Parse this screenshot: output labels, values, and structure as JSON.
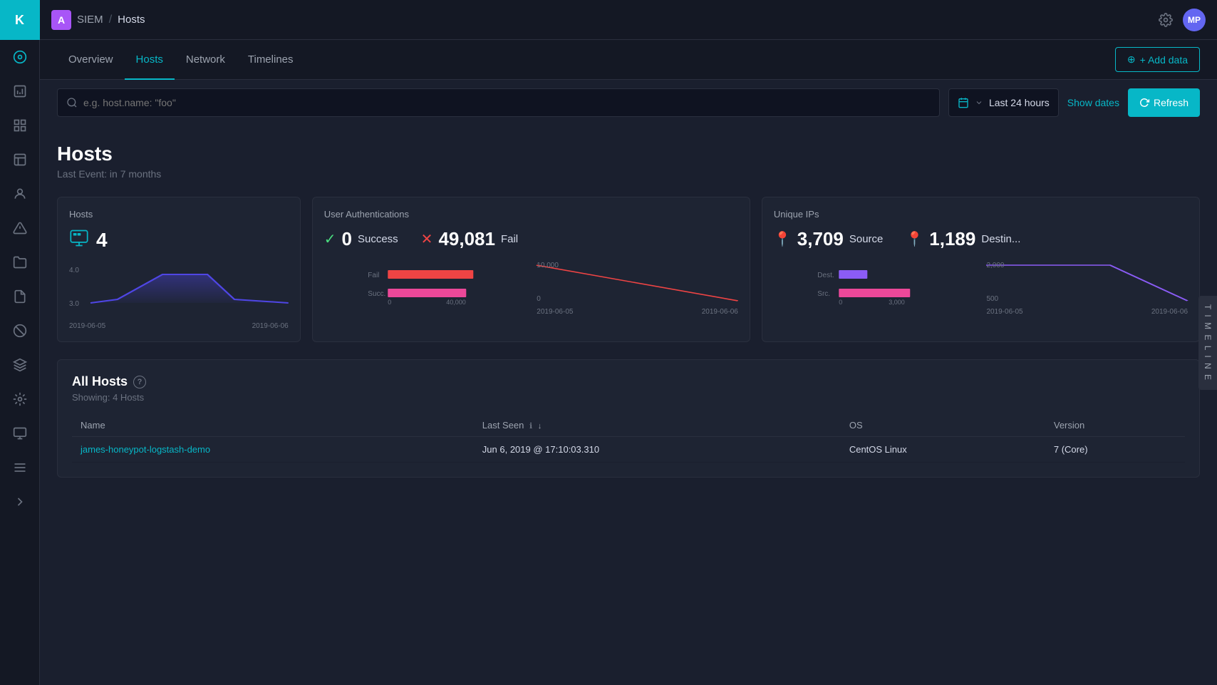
{
  "app": {
    "logo_text": "K",
    "app_icon_text": "A",
    "siem_label": "SIEM",
    "separator": "/",
    "page_name": "Hosts",
    "avatar_text": "MP"
  },
  "nav": {
    "tabs": [
      {
        "id": "overview",
        "label": "Overview",
        "active": false
      },
      {
        "id": "hosts",
        "label": "Hosts",
        "active": true
      },
      {
        "id": "network",
        "label": "Network",
        "active": false
      },
      {
        "id": "timelines",
        "label": "Timelines",
        "active": false
      }
    ],
    "add_data_label": "+ Add data"
  },
  "filter": {
    "search_placeholder": "e.g. host.name: \"foo\"",
    "time_range": "Last 24 hours",
    "show_dates_label": "Show dates",
    "refresh_label": "Refresh"
  },
  "page": {
    "title": "Hosts",
    "subtitle": "Last Event: in 7 months"
  },
  "cards": {
    "hosts": {
      "title": "Hosts",
      "count": "4",
      "chart_y_high": "4.0",
      "chart_y_low": "3.0",
      "date_start": "2019-06-05",
      "date_end": "2019-06-06"
    },
    "auth": {
      "title": "User Authentications",
      "success_count": "0",
      "success_label": "Success",
      "fail_count": "49,081",
      "fail_label": "Fail",
      "bar_y_fail": "Fail",
      "bar_y_succ": "Succ.",
      "bar_x_0": "0",
      "bar_x_40k": "40,000",
      "chart_y_high": "10,000",
      "chart_y_low": "0",
      "date_start": "2019-06-05",
      "date_end": "2019-06-06"
    },
    "ips": {
      "title": "Unique IPs",
      "source_count": "3,709",
      "source_label": "Source",
      "dest_count": "1,189",
      "dest_label": "Destin...",
      "bar_y_dest": "Dest.",
      "bar_y_src": "Src.",
      "bar_x_0": "0",
      "bar_x_3k": "3,000",
      "chart_y_high": "2,000",
      "chart_y_low": "500",
      "date_start": "2019-06-05",
      "date_end": "2019-06-06"
    }
  },
  "table": {
    "title": "All Hosts",
    "showing": "Showing: 4 Hosts",
    "columns": [
      {
        "id": "name",
        "label": "Name"
      },
      {
        "id": "last_seen",
        "label": "Last Seen"
      },
      {
        "id": "os",
        "label": "OS"
      },
      {
        "id": "version",
        "label": "Version"
      }
    ],
    "rows": [
      {
        "name": "james-honeypot-logstash-demo",
        "last_seen": "Jun 6, 2019 @ 17:10:03.310",
        "os": "CentOS Linux",
        "version": "7 (Core)"
      }
    ]
  },
  "timeline": {
    "label": "T I M E L I N E"
  },
  "colors": {
    "accent": "#07b7c7",
    "success": "#4ade80",
    "fail": "#ef4444",
    "source": "#ec4899",
    "dest": "#8b5cf6",
    "host_line": "#6366f1"
  }
}
